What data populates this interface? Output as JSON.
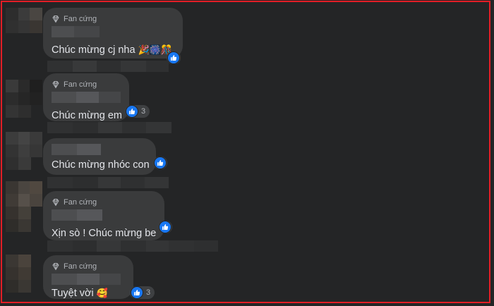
{
  "comments": [
    {
      "badge": "Fan cứng",
      "text": "Chúc mừng cj nha",
      "emojis": [
        "🎉",
        "🎆",
        "🎊"
      ],
      "reaction_count": ""
    },
    {
      "badge": "Fan cứng",
      "text": "Chúc mừng em",
      "reaction_count": "3"
    },
    {
      "badge": "",
      "text": "Chúc mừng nhóc con",
      "reaction_count": ""
    },
    {
      "badge": "Fan cứng",
      "text": "Xịn sò ! Chúc mừng be",
      "reaction_count": ""
    },
    {
      "badge": "Fan cứng",
      "text": "Tuyệt vời",
      "emojis": [
        "🥰"
      ],
      "reaction_count": "3"
    }
  ],
  "colors": {
    "background": "#242526",
    "bubble": "#3a3b3c",
    "text": "#e4e6eb",
    "secondary_text": "#b0b3b8",
    "like_blue": "#1877f2",
    "frame_red": "#e41e26"
  },
  "icons": [
    "diamond-icon",
    "like-icon"
  ]
}
